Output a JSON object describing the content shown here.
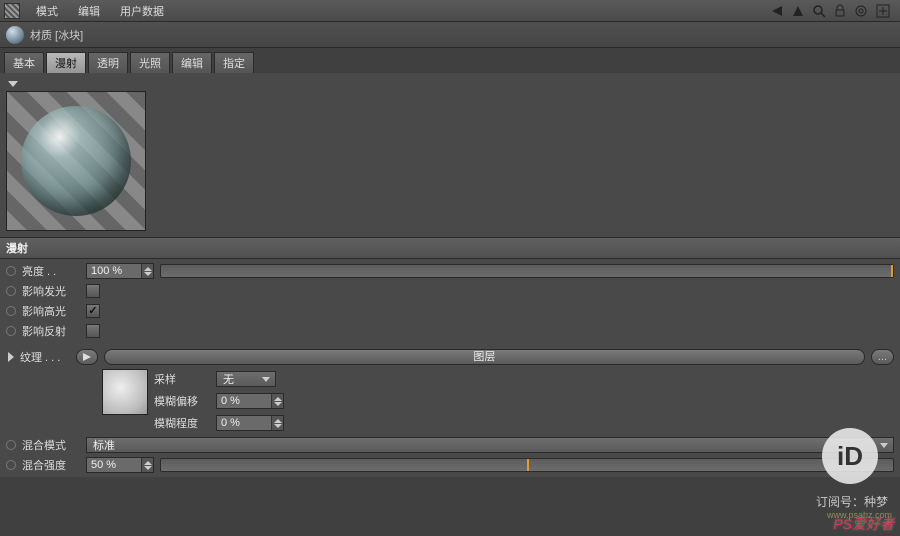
{
  "menubar": {
    "items": [
      "模式",
      "编辑",
      "用户数据"
    ]
  },
  "title": "材质 [冰块]",
  "tabs": [
    "基本",
    "漫射",
    "透明",
    "光照",
    "编辑",
    "指定"
  ],
  "activeTab": 1,
  "section": {
    "header": "漫射"
  },
  "params": {
    "brightness": {
      "label": "亮度 . .",
      "value": "100 %",
      "sliderPercent": 100
    },
    "affectLuminance": {
      "label": "影响发光",
      "checked": false
    },
    "affectSpecular": {
      "label": "影响高光",
      "checked": true
    },
    "affectReflection": {
      "label": "影响反射",
      "checked": false
    }
  },
  "texture": {
    "label": "纹理 . . .",
    "layerButton": "图层",
    "browse": "...",
    "sampling": {
      "label": "采样",
      "value": "无"
    },
    "blurOffset": {
      "label": "模糊偏移",
      "value": "0 %"
    },
    "blurScale": {
      "label": "模糊程度",
      "value": "0 %"
    }
  },
  "blend": {
    "mode": {
      "label": "混合模式",
      "value": "标准"
    },
    "strength": {
      "label": "混合强度",
      "value": "50 %",
      "sliderPercent": 50
    }
  },
  "watermark": {
    "badge": "iD",
    "subscribe": "订阅号：种梦",
    "site": "PS爱好者",
    "url": "www.psahz.com"
  }
}
